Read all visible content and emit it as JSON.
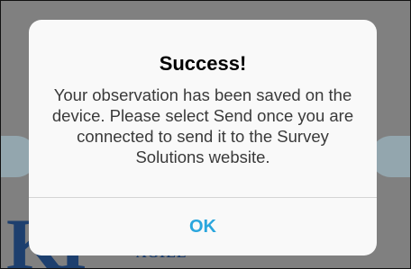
{
  "dialog": {
    "title": "Success!",
    "message": "Your observation has been saved on the device. Please select Send once you are connected to send it to the Survey Solutions website.",
    "ok_label": "OK"
  },
  "background": {
    "logo_text": "KI",
    "tagline": "AGILE"
  },
  "colors": {
    "overlay": "#808080",
    "dialog_background": "#f9f9f9",
    "button_text": "#2aa6dd",
    "logo": "#1d3f6e"
  }
}
